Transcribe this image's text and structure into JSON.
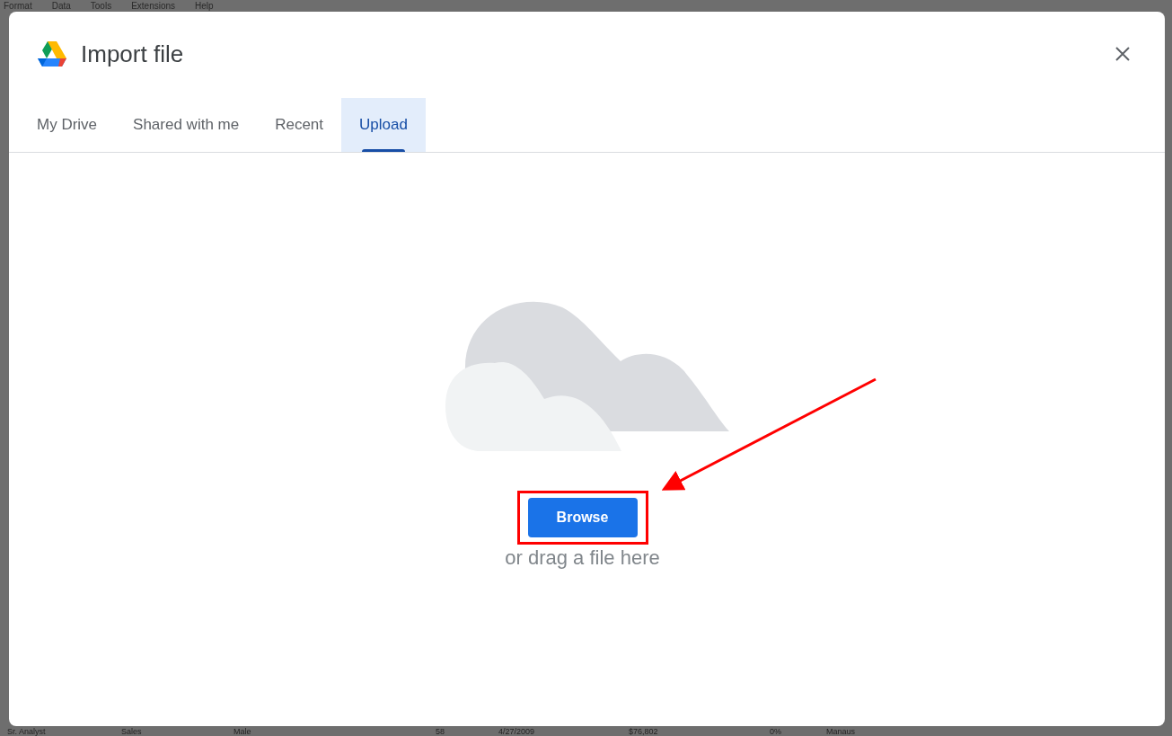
{
  "background": {
    "menu": [
      "Format",
      "Data",
      "Tools",
      "Extensions",
      "Help"
    ],
    "row": [
      "Sr. Analyst",
      "Sales",
      "Male",
      "58",
      "4/27/2009",
      "$76,802",
      "0%",
      "Manaus"
    ]
  },
  "dialog": {
    "title": "Import file",
    "tabs": [
      {
        "label": "My Drive",
        "selected": false
      },
      {
        "label": "Shared with me",
        "selected": false
      },
      {
        "label": "Recent",
        "selected": false
      },
      {
        "label": "Upload",
        "selected": true
      }
    ],
    "upload": {
      "button": "Browse",
      "hint": "or drag a file here"
    }
  }
}
